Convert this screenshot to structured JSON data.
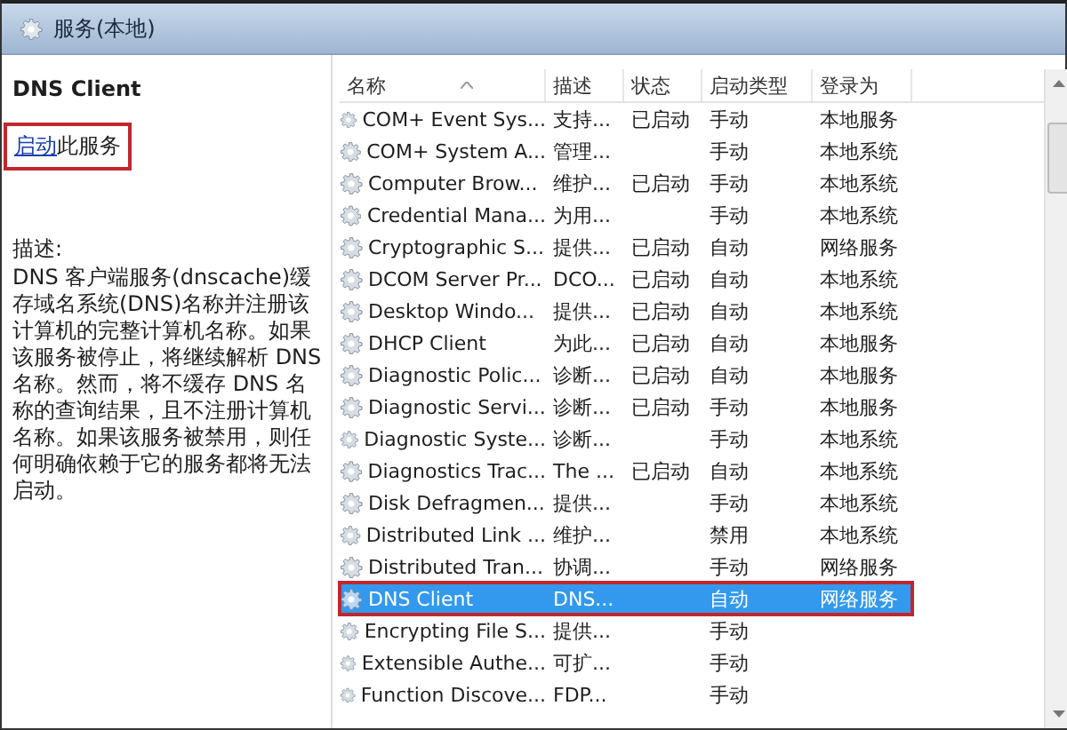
{
  "header": {
    "title": "服务(本地)"
  },
  "detail": {
    "service_name": "DNS Client",
    "action": {
      "link": "启动",
      "rest": "此服务",
      "highlighted": true
    },
    "description_label": "描述:",
    "description": "DNS 客户端服务(dnscache)缓存域名系统(DNS)名称并注册该计算机的完整计算机名称。如果该服务被停止，将继续解析 DNS 名称。然而，将不缓存 DNS 名称的查询结果，且不注册计算机名称。如果该服务被禁用，则任何明确依赖于它的服务都将无法启动。"
  },
  "table": {
    "columns": [
      "名称",
      "描述",
      "状态",
      "启动类型",
      "登录为"
    ],
    "rows": [
      {
        "name": "COM+ Event Sys...",
        "description": "支持...",
        "status": "已启动",
        "startup_type": "手动",
        "log_on_as": "本地服务",
        "selected": false,
        "highlighted": false
      },
      {
        "name": "COM+ System A...",
        "description": "管理...",
        "startup_type": "手动",
        "log_on_as": "本地系统",
        "selected": false,
        "highlighted": false
      },
      {
        "name": "Computer Brow...",
        "description": "维护...",
        "status": "已启动",
        "startup_type": "手动",
        "log_on_as": "本地系统",
        "selected": false,
        "highlighted": false
      },
      {
        "name": "Credential Mana...",
        "description": "为用...",
        "startup_type": "手动",
        "log_on_as": "本地系统",
        "selected": false,
        "highlighted": false
      },
      {
        "name": "Cryptographic S...",
        "description": "提供...",
        "status": "已启动",
        "startup_type": "自动",
        "log_on_as": "网络服务",
        "selected": false,
        "highlighted": false
      },
      {
        "name": "DCOM Server Pr...",
        "description": "DCO...",
        "status": "已启动",
        "startup_type": "自动",
        "log_on_as": "本地系统",
        "selected": false,
        "highlighted": false
      },
      {
        "name": "Desktop Windo...",
        "description": "提供...",
        "status": "已启动",
        "startup_type": "自动",
        "log_on_as": "本地系统",
        "selected": false,
        "highlighted": false
      },
      {
        "name": "DHCP Client",
        "description": "为此...",
        "status": "已启动",
        "startup_type": "自动",
        "log_on_as": "本地服务",
        "selected": false,
        "highlighted": false
      },
      {
        "name": "Diagnostic Polic...",
        "description": "诊断...",
        "status": "已启动",
        "startup_type": "自动",
        "log_on_as": "本地服务",
        "selected": false,
        "highlighted": false
      },
      {
        "name": "Diagnostic Servi...",
        "description": "诊断...",
        "status": "已启动",
        "startup_type": "手动",
        "log_on_as": "本地服务",
        "selected": false,
        "highlighted": false
      },
      {
        "name": "Diagnostic Syste...",
        "description": "诊断...",
        "startup_type": "手动",
        "log_on_as": "本地系统",
        "selected": false,
        "highlighted": false
      },
      {
        "name": "Diagnostics Trac...",
        "description": "The ...",
        "status": "已启动",
        "startup_type": "自动",
        "log_on_as": "本地系统",
        "selected": false,
        "highlighted": false
      },
      {
        "name": "Disk Defragmen...",
        "description": "提供...",
        "startup_type": "手动",
        "log_on_as": "本地系统",
        "selected": false,
        "highlighted": false
      },
      {
        "name": "Distributed Link ...",
        "description": "维护...",
        "startup_type": "禁用",
        "log_on_as": "本地系统",
        "selected": false,
        "highlighted": false
      },
      {
        "name": "Distributed Tran...",
        "description": "协调...",
        "startup_type": "手动",
        "log_on_as": "网络服务",
        "selected": false,
        "highlighted": false
      },
      {
        "name": "DNS Client",
        "description": "DNS...",
        "startup_type": "自动",
        "log_on_as": "网络服务",
        "selected": true,
        "highlighted": true
      },
      {
        "name": "Encrypting File S...",
        "description": "提供...",
        "startup_type": "手动",
        "selected": false,
        "highlighted": false
      },
      {
        "name": "Extensible Authe...",
        "description": "可扩...",
        "startup_type": "手动",
        "selected": false,
        "highlighted": false
      },
      {
        "name": "Function Discove...",
        "description": "FDP...",
        "startup_type": "手动",
        "selected": false,
        "highlighted": false
      }
    ]
  }
}
